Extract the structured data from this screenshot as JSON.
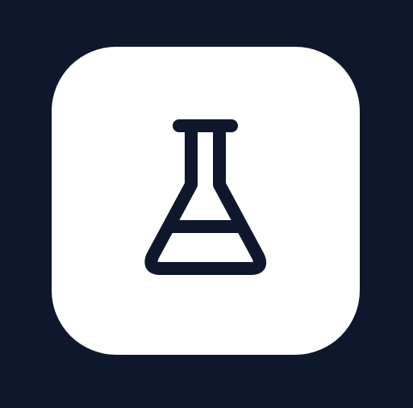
{
  "app_icon": {
    "icon": "flask-icon",
    "tile_color": "#ffffff",
    "background_color": "#0e172b",
    "icon_color": "#0e172b"
  }
}
